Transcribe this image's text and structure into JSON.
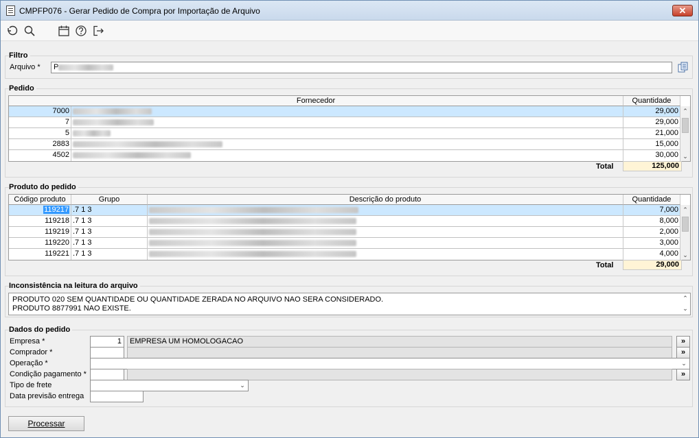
{
  "window": {
    "title": "CMPFP076 - Gerar Pedido de Compra por Importação de Arquivo",
    "close_label": "✕"
  },
  "toolbar": {
    "icons": [
      "undo-icon",
      "search-icon",
      "calendar-icon",
      "help-icon",
      "exit-icon"
    ]
  },
  "filtro": {
    "legend": "Filtro",
    "arquivo_label": "Arquivo *",
    "arquivo_value": "P"
  },
  "pedido": {
    "legend": "Pedido",
    "columns": [
      "Fornecedor",
      "Quantidade"
    ],
    "rows": [
      {
        "code": "7000",
        "qty": "29,000"
      },
      {
        "code": "7",
        "qty": "29,000"
      },
      {
        "code": "5",
        "qty": "21,000"
      },
      {
        "code": "2883",
        "qty": "15,000"
      },
      {
        "code": "4502",
        "qty": "30,000"
      }
    ],
    "total_label": "Total",
    "total_value": "125,000"
  },
  "produto": {
    "legend": "Produto do pedido",
    "columns": [
      "Código produto",
      "Grupo",
      "Descrição do produto",
      "Quantidade"
    ],
    "rows": [
      {
        "code": "119217",
        "grupo": ".7 1 3",
        "qty": "7,000"
      },
      {
        "code": "119218",
        "grupo": ".7 1 3",
        "qty": "8,000"
      },
      {
        "code": "119219",
        "grupo": ".7 1 3",
        "qty": "2,000"
      },
      {
        "code": "119220",
        "grupo": ".7 1 3",
        "qty": "3,000"
      },
      {
        "code": "119221",
        "grupo": ".7 1 3",
        "qty": "4,000"
      }
    ],
    "total_label": "Total",
    "total_value": "29,000"
  },
  "inconsistencia": {
    "legend": "Inconsistência na leitura do arquivo",
    "lines": [
      "PRODUTO 020 SEM QUANTIDADE OU QUANTIDADE ZERADA NO ARQUIVO NAO SERA CONSIDERADO.",
      "PRODUTO 8877991 NAO EXISTE."
    ]
  },
  "dados": {
    "legend": "Dados do pedido",
    "empresa_label": "Empresa *",
    "empresa_code": "1",
    "empresa_name": "EMPRESA UM HOMOLOGACAO",
    "comprador_label": "Comprador *",
    "operacao_label": "Operação *",
    "condicao_label": "Condição pagamento *",
    "frete_label": "Tipo de frete",
    "data_label": "Data previsão entrega",
    "lookup_label": "»"
  },
  "actions": {
    "processar_label": "Processar"
  }
}
